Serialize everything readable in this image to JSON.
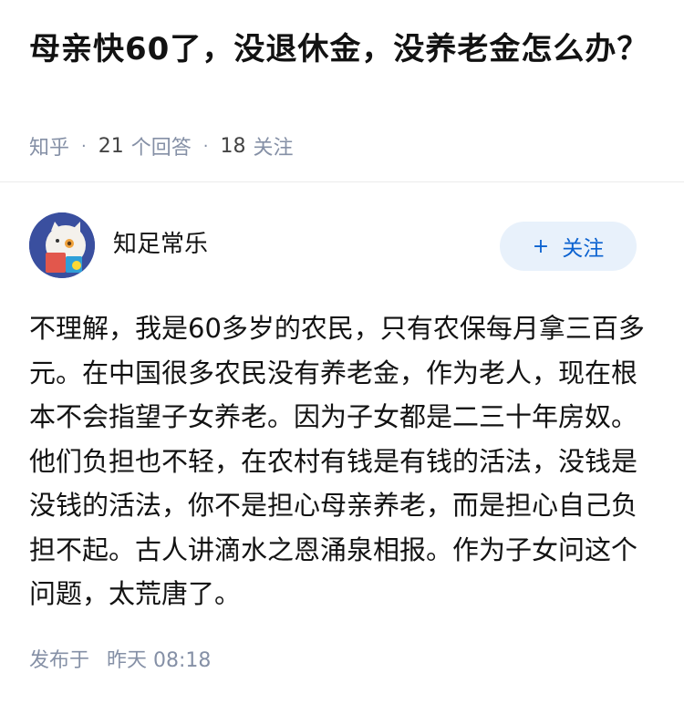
{
  "question": {
    "title": "母亲快60了，没退休金，没养老金怎么办？",
    "source": "知乎",
    "answer_count": "21",
    "answer_label": "个回答",
    "follow_count": "18",
    "follow_label": "关注"
  },
  "answer": {
    "author_name": "知足常乐",
    "follow_button": {
      "icon": "plus-icon",
      "label": "关注"
    },
    "content": "不理解，我是60多岁的农民，只有农保每月拿三百多元。在中国很多农民没有养老金，作为老人，现在根本不会指望子女养老。因为子女都是二三十年房奴。他们负担也不轻，在农村有钱是有钱的活法，没钱是没钱的活法，你不是担心母亲养老，而是担心自己负担不起。古人讲滴水之恩涌泉相报。作为子女问这个问题，太荒唐了。",
    "publish_label": "发布于",
    "publish_time": "昨天 08:18"
  },
  "colors": {
    "accent": "#0b62d0",
    "follow_bg": "#e8f1fb",
    "meta_text": "#8590a6",
    "avatar_bg": "#3a4f9f"
  }
}
